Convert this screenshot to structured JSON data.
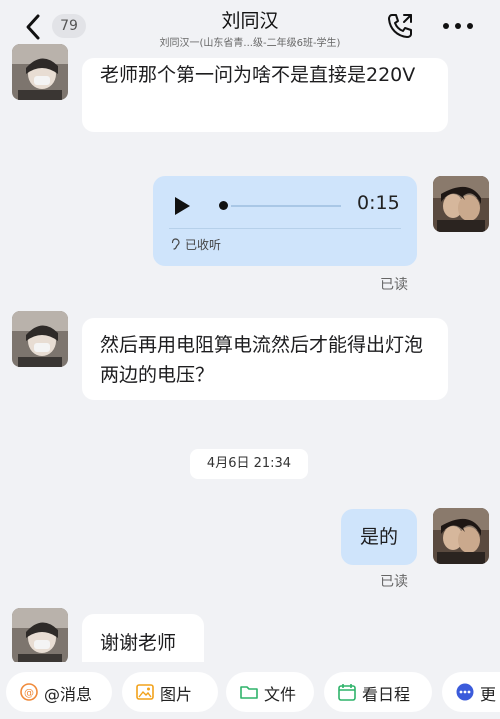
{
  "header": {
    "unread_count": "79",
    "title": "刘同汉",
    "subtitle": "刘同汉一(山东省青...级-二年级6班-学生)"
  },
  "messages": {
    "m1": {
      "text": "老师那个第一问为啥不是直接是220V"
    },
    "voice": {
      "duration": "0:15",
      "heard": "已收听",
      "progress": 0.05,
      "read": "已读"
    },
    "m3": {
      "text": "然后再用电阻算电流然后才能得出灯泡两边的电压？"
    },
    "divider": "4月6日 21:34",
    "m4": {
      "text": "是的",
      "read": "已读"
    },
    "m5": {
      "text": "谢谢老师"
    }
  },
  "toolbar": {
    "mention": "@消息",
    "image": "图片",
    "file": "文件",
    "schedule": "看日程",
    "more": "更"
  },
  "colors": {
    "background": "#f1f2f5",
    "outgoing_bubble": "#cfe4fb",
    "incoming_bubble": "#ffffff"
  }
}
